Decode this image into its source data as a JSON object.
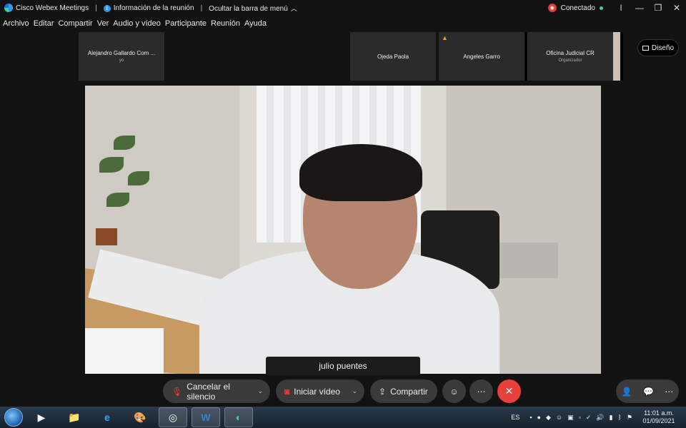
{
  "titlebar": {
    "app_name": "Cisco Webex Meetings",
    "meeting_info": "Información de la reunión",
    "hide_menu": "Ocultar la barra de menú",
    "status": "Conectado"
  },
  "menu": [
    "Archivo",
    "Editar",
    "Compartir",
    "Ver",
    "Audio y vídeo",
    "Participante",
    "Reunión",
    "Ayuda"
  ],
  "participants": {
    "p1_name": "Alejandro Gallardo Com ...",
    "p1_sub": "yo",
    "p4_name": "Ojeda Paola",
    "p5_name": "Angeles Garro",
    "p6_name": "Oficina Judicial CR",
    "p6_sub": "Organizador"
  },
  "layout_label": "Diseño",
  "active_speaker": "julio puentes",
  "controls": {
    "mute": "Cancelar el silencio",
    "video": "Iniciar vídeo",
    "share": "Compartir"
  },
  "tray": {
    "lang": "ES",
    "time": "11:01 a.m.",
    "date": "01/09/2021"
  },
  "colors": {
    "accent_red": "#e8413a",
    "connected_green": "#3dd68c",
    "background": "#121212"
  }
}
